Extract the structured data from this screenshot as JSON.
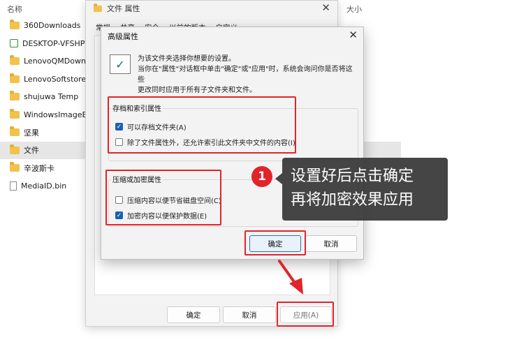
{
  "explorer": {
    "column_name": "名称",
    "column_size": "大小",
    "items": [
      {
        "label": "360Downloads",
        "icon": "folder-icon"
      },
      {
        "label": "DESKTOP-VFSHPVC",
        "icon": "computer-icon"
      },
      {
        "label": "LenovoQMDownload",
        "icon": "folder-icon"
      },
      {
        "label": "LenovoSoftstore",
        "icon": "folder-icon"
      },
      {
        "label": "shujuwa Temp",
        "icon": "folder-icon"
      },
      {
        "label": "WindowsImageBackup",
        "icon": "folder-icon"
      },
      {
        "label": "坚果",
        "icon": "folder-icon"
      },
      {
        "label": "文件",
        "icon": "folder-icon"
      },
      {
        "label": "辛波斯卡",
        "icon": "folder-icon"
      },
      {
        "label": "MediaID.bin",
        "icon": "file-icon"
      }
    ]
  },
  "properties": {
    "title": "文件 属性",
    "tabs": [
      "常规",
      "共享",
      "安全",
      "以前的版本",
      "自定义"
    ],
    "ok_label": "确定",
    "cancel_label": "取消",
    "apply_label": "应用(A)"
  },
  "advanced": {
    "title": "高级属性",
    "intro_line1": "为该文件夹选择你想要的设置。",
    "intro_line2": "当你在\"属性\"对话框中单击\"确定\"或\"应用\"时，系统会询问你是否将这些",
    "intro_line3": "更改同时应用于所有子文件夹和文件。",
    "archive_group": "存档和索引属性",
    "archive_option": "可以存档文件夹(A)",
    "index_option": "除了文件属性外，还允许索引此文件夹中文件的内容(I)",
    "compress_group": "压缩或加密属性",
    "compress_option": "压缩内容以便节省磁盘空间(C)",
    "encrypt_option": "加密内容以便保护数据(E)",
    "ok_label": "确定",
    "cancel_label": "取消"
  },
  "annotation": {
    "step_number": "1",
    "line1": "设置好后点击确定",
    "line2": "再将加密效果应用",
    "highlight_color": "#e2242a"
  }
}
